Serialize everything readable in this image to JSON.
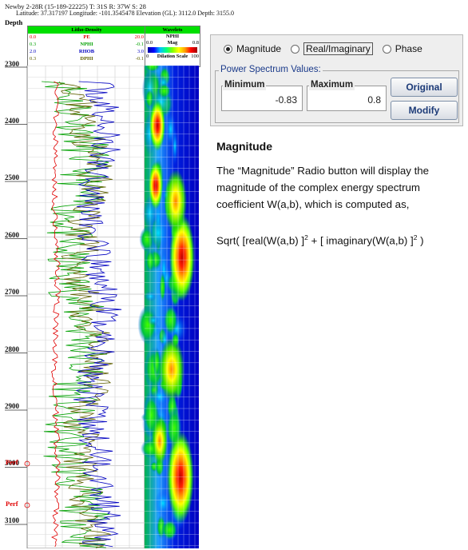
{
  "well": {
    "title": "Newby 2-28R (15-189-22225) T: 31S R: 37W S: 28",
    "subtitle": "Latitude: 37.317197 Longitude: -101.3545478 Elevation (GL): 3112.0 Depth: 3155.0"
  },
  "tracks": {
    "depth_header": "Depth",
    "litho": {
      "title": "Litho-Density",
      "curves": [
        {
          "min": "0.0",
          "name": "PE",
          "max": "20.0",
          "color": "#e00000"
        },
        {
          "min": "0.3",
          "name": "NPHI",
          "max": "-0.1",
          "color": "#00a000"
        },
        {
          "min": "2.0",
          "name": "RHOB",
          "max": "3.0",
          "color": "#0000c0"
        },
        {
          "min": "0.3",
          "name": "DPHI",
          "max": "-0.1",
          "color": "#606000"
        }
      ]
    },
    "wavelets": {
      "title": "Wavelets",
      "curve": "NPHI",
      "mag_label": "Mag",
      "mag_min": "0.0",
      "mag_max": "0.8",
      "scale_label": "Dilation Scale",
      "scale_min": "0",
      "scale_max": "100"
    }
  },
  "depth_marks": [
    "2300",
    "2400",
    "2500",
    "2600",
    "2700",
    "2800",
    "2900",
    "3000",
    "3100"
  ],
  "perf_labels": [
    "Perf",
    "Perf"
  ],
  "dialog": {
    "radios": [
      {
        "label": "Magnitude",
        "selected": true
      },
      {
        "label": "Real/Imaginary",
        "selected": false
      },
      {
        "label": "Phase",
        "selected": false
      }
    ],
    "group_title": "Power Spectrum Values:",
    "minimum": {
      "label": "Minimum",
      "value": "-0.83"
    },
    "maximum": {
      "label": "Maximum",
      "value": "0.8"
    },
    "original_button": "Original",
    "modify_button": "Modify"
  },
  "description": {
    "heading": "Magnitude",
    "body": "The “Magnitude” Radio button will display the magnitude of the complex energy spectrum coefficient W(a,b), which is computed as,",
    "formula_a": "Sqrt( [real(W(a,b) ]",
    "formula_b": " + [ imaginary(W(a,b) ]",
    "formula_c": " )",
    "sup": "2"
  },
  "colors": {
    "header_green": "#00e000",
    "pe_curve": "#e00000",
    "nphi_curve": "#00a000",
    "rhob_curve": "#0000c0",
    "dphi_curve": "#606000"
  }
}
